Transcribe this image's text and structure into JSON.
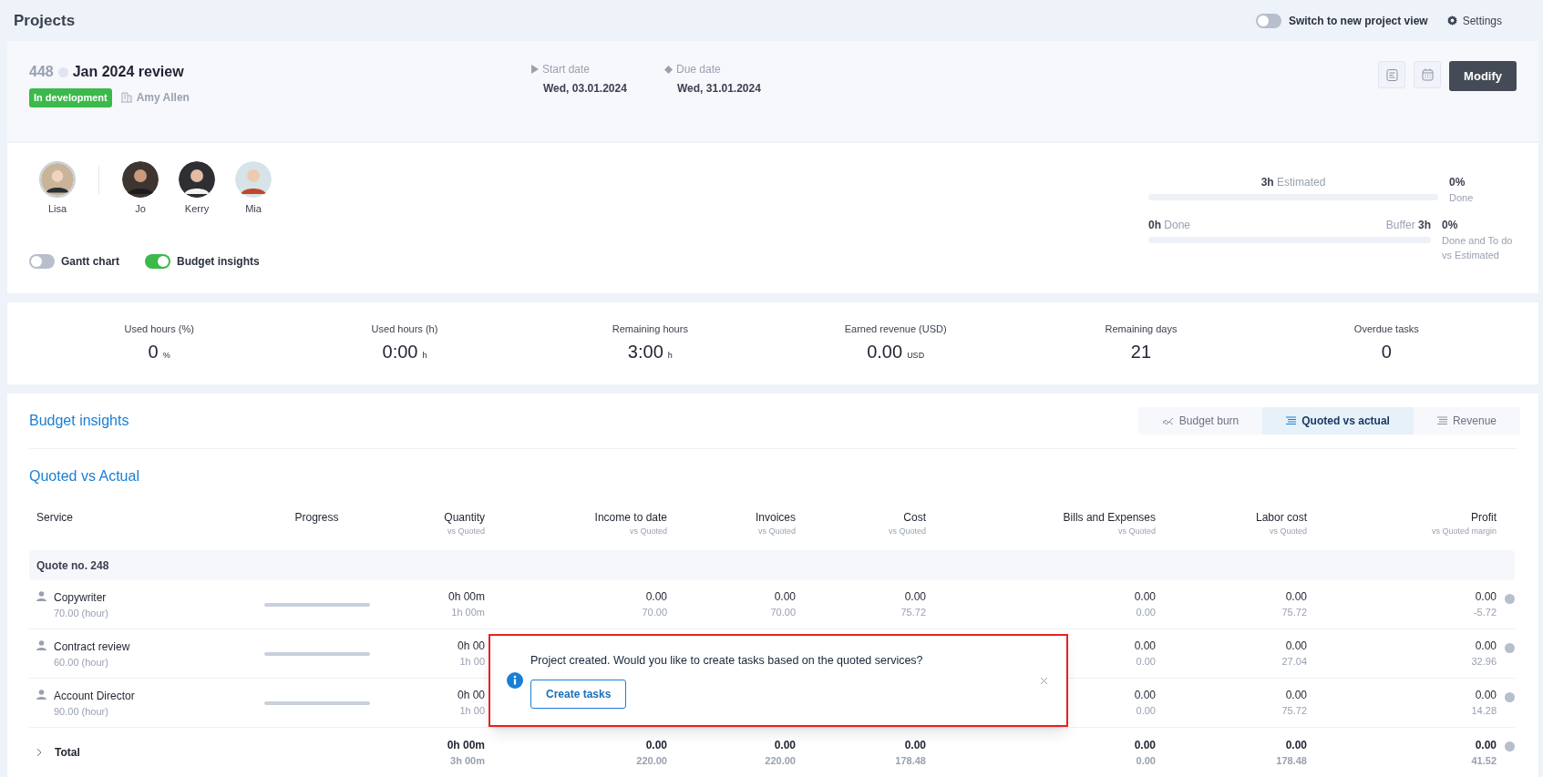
{
  "page_title": "Projects",
  "header_actions": {
    "new_view_toggle": {
      "label": "Switch to new project view",
      "on": false
    },
    "settings": "Settings"
  },
  "project": {
    "number": "448",
    "name": "Jan 2024 review",
    "status": {
      "label": "In development",
      "color": "#3cb94b"
    },
    "client": "Amy Allen",
    "start": {
      "label": "Start date",
      "value": "Wed, 03.01.2024"
    },
    "due": {
      "label": "Due date",
      "value": "Wed, 31.01.2024"
    },
    "modify_button": "Modify"
  },
  "team": [
    {
      "name": "Lisa",
      "kind": "owner"
    },
    {
      "name": "Jo",
      "kind": "member"
    },
    {
      "name": "Kerry",
      "kind": "member"
    },
    {
      "name": "Mia",
      "kind": "member"
    }
  ],
  "toggles": [
    {
      "label": "Gantt chart",
      "on": false
    },
    {
      "label": "Budget insights",
      "on": true
    }
  ],
  "hours": {
    "estimated_value": "3h",
    "estimated_label": "Estimated",
    "estimated_bar": {
      "level": 0
    },
    "done_value": "0h",
    "done_label": "Done",
    "buffer_label": "Buffer",
    "buffer_value": "3h",
    "done_bar": {
      "level": 0
    },
    "done_pct": "0%",
    "done_pct_label": "Done",
    "done_todo_pct": "0%",
    "done_todo_label": "Done and To do vs Estimated"
  },
  "stats": [
    {
      "label": "Used hours (%)",
      "value": "0",
      "unit": "%"
    },
    {
      "label": "Used hours (h)",
      "value": "0:00",
      "unit": "h"
    },
    {
      "label": "Remaining hours",
      "value": "3:00",
      "unit": "h"
    },
    {
      "label": "Earned revenue (USD)",
      "value": "0.00",
      "unit": "USD"
    },
    {
      "label": "Remaining days",
      "value": "21"
    },
    {
      "label": "Overdue tasks",
      "value": "0"
    }
  ],
  "budget": {
    "title": "Budget insights",
    "tabs": [
      {
        "label": "Budget burn",
        "selected": false
      },
      {
        "label": "Quoted vs actual",
        "selected": true
      },
      {
        "label": "Revenue",
        "selected": false
      }
    ],
    "section_title": "Quoted vs Actual",
    "table": {
      "columns": [
        {
          "title": "Service"
        },
        {
          "title": "Progress"
        },
        {
          "title": "Quantity",
          "subtitle": "vs Quoted"
        },
        {
          "title": "Income to date",
          "subtitle": "vs Quoted"
        },
        {
          "title": "Invoices",
          "subtitle": "vs Quoted"
        },
        {
          "title": "Cost",
          "subtitle": "vs Quoted"
        },
        {
          "title": "Bills and Expenses",
          "subtitle": "vs Quoted"
        },
        {
          "title": "Labor cost",
          "subtitle": "vs Quoted"
        },
        {
          "title": "Profit",
          "subtitle": "vs Quoted margin"
        }
      ],
      "group": "Quote no. 248",
      "rows": [
        {
          "service": "Copywriter",
          "rate": "70.00 (hour)",
          "progress": {
            "level": 0
          },
          "quantity": [
            "0h 00m",
            "1h 00m"
          ],
          "income": [
            "0.00",
            "70.00"
          ],
          "invoices": [
            "0.00",
            "70.00"
          ],
          "cost": [
            "0.00",
            "75.72"
          ],
          "bills": [
            "0.00",
            "0.00"
          ],
          "labor": [
            "0.00",
            "75.72"
          ],
          "profit": [
            "0.00",
            "-5.72"
          ]
        },
        {
          "service": "Contract review",
          "rate": "60.00 (hour)",
          "progress": {
            "level": 0
          },
          "quantity": [
            "0h 00",
            "1h 00"
          ],
          "bills": [
            "0.00",
            "0.00"
          ],
          "labor": [
            "0.00",
            "27.04"
          ],
          "profit": [
            "0.00",
            "32.96"
          ]
        },
        {
          "service": "Account Director",
          "rate": "90.00 (hour)",
          "progress": {
            "level": 0
          },
          "quantity": [
            "0h 00",
            "1h 00"
          ],
          "bills": [
            "0.00",
            "0.00"
          ],
          "labor": [
            "0.00",
            "75.72"
          ],
          "profit": [
            "0.00",
            "14.28"
          ]
        }
      ],
      "total": {
        "label": "Total",
        "quantity": [
          "0h 00m",
          "3h 00m"
        ],
        "income": [
          "0.00",
          "220.00"
        ],
        "invoices": [
          "0.00",
          "220.00"
        ],
        "cost": [
          "0.00",
          "178.48"
        ],
        "bills": [
          "0.00",
          "0.00"
        ],
        "labor": [
          "0.00",
          "178.48"
        ],
        "profit": [
          "0.00",
          "41.52"
        ]
      }
    }
  },
  "toast": {
    "message": "Project created. Would you like to create tasks based on the quoted services?",
    "button": "Create tasks"
  }
}
